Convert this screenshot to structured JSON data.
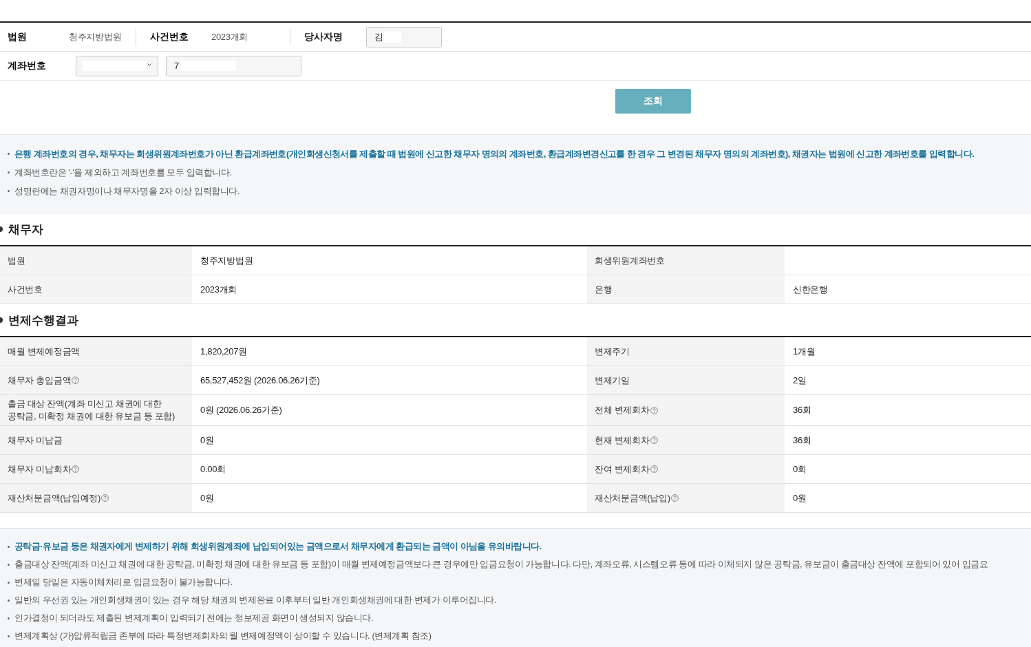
{
  "search_form": {
    "court": {
      "label": "법원",
      "value": "청주지방법원"
    },
    "case_number": {
      "label": "사건번호",
      "value": "2023개회"
    },
    "party_name": {
      "label": "당사자명",
      "value": "김",
      "redacted": true
    },
    "account_number": {
      "label": "계좌번호",
      "bank_select": {
        "redacted": true
      },
      "value": "7",
      "redacted": true
    },
    "search_button": "조회"
  },
  "notice": [
    {
      "text": "은행 계좌번호의 경우, 채무자는 회생위원계좌번호가 아닌 환급계좌번호(개인회생신청서를 제출할 때 법원에 신고한 채무자 명의의 계좌번호, 환급계좌변경신고를 한 경우 그 변경된 채무자 명의의 계좌번호), 채권자는 법원에 신고한 계좌번호를 입력합니다.",
      "emphasis": true
    },
    {
      "text": "계좌번호란은 '-'을 제외하고 계좌번호를 모두 입력합니다.",
      "emphasis": false
    },
    {
      "text": "성명란에는 채권자명이나 채무자명을 2자 이상 입력합니다.",
      "emphasis": false
    }
  ],
  "debtor": {
    "title": "채무자",
    "rows": [
      {
        "cells": [
          {
            "label": "법원",
            "value": "청주지방법원"
          },
          {
            "label": "회생위원계좌번호"
          }
        ]
      },
      {
        "cells": [
          {
            "label": "사건번호",
            "value": "2023개회"
          },
          {
            "label": "은행",
            "value": "신한은행"
          }
        ]
      }
    ]
  },
  "results": {
    "title": "변제수행결과",
    "rows": [
      {
        "cells": [
          {
            "label": "매월 변제예정금액",
            "help": false,
            "value": "1,820,207원"
          },
          {
            "label": "변제주기",
            "help": false,
            "value": "1개월"
          }
        ]
      },
      {
        "cells": [
          {
            "label": "채무자 총입금액",
            "help": true,
            "value": "65,527,452원 (2026.06.26기준)"
          },
          {
            "label": "변제기일",
            "help": false,
            "value": "2일"
          }
        ]
      },
      {
        "cells": [
          {
            "label": "출금 대상 잔액(계좌 미신고 채권에 대한 공탁금, 미확정 채권에 대한 유보금 등 포함)",
            "help": false,
            "value": "0원 (2026.06.26기준)"
          },
          {
            "label": "전체 변제회차",
            "help": true,
            "value": "36회"
          }
        ]
      },
      {
        "cells": [
          {
            "label": "채무자 미납금",
            "help": false,
            "value": "0원"
          },
          {
            "label": "현재 변제회차",
            "help": true,
            "value": "36회"
          }
        ]
      },
      {
        "cells": [
          {
            "label": "채무자 미납회차",
            "help": true,
            "value": "0.00회"
          },
          {
            "label": "잔여 변제회차",
            "help": true,
            "value": "0회"
          }
        ]
      },
      {
        "cells": [
          {
            "label": "재산처분금액(납입예정)",
            "help": true,
            "value": "0원"
          },
          {
            "label": "재산처분금액(납입)",
            "help": true,
            "value": "0원"
          }
        ]
      }
    ]
  },
  "notes": [
    {
      "text": "공탁금·유보금 등은 채권자에게 변제하기 위해 회생위원계좌에 납입되어있는 금액으로서 채무자에게 환급되는 금액이 아님을 유의바랍니다.",
      "emphasis": true
    },
    {
      "text": "출금대상 잔액(계좌 미신고 채권에 대한 공탁금, 미확정 채권에 대한 유보금 등 포함)이 매월 변제예정금액보다 큰 경우에만 입금요청이 가능합니다. 다만, 계좌오류, 시스템오류 등에 따라 이체되지 않은 공탁금, 유보금이 출금대상 잔액에 포함되어 있어 입금요",
      "emphasis": false
    },
    {
      "text": "변제일 당일은 자동이체처리로 입금요청이 불가능합니다.",
      "emphasis": false
    },
    {
      "text": "일반의 우선권 있는 개인회생채권이 있는 경우 해당 채권의 변제완료 이후부터 일반 개인회생채권에 대한 변제가 이루어집니다.",
      "emphasis": false
    },
    {
      "text": "인가결정이 되더라도 제출된 변제계획이 입력되기 전에는 정보제공 화면이 생성되지 않습니다.",
      "emphasis": false
    },
    {
      "text": "변제계획상 (가)압류적립금 존부에 따라 특정변제회차의 월 변제예정액이 상이할 수 있습니다. (변제계획 참조)",
      "emphasis": false
    }
  ]
}
